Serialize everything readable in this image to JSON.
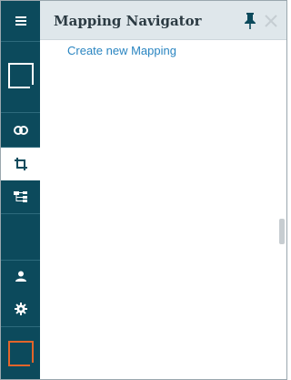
{
  "header": {
    "title": "Mapping Navigator"
  },
  "content": {
    "create_link": "Create new Mapping"
  },
  "rail": {
    "items": [
      {
        "icon": "menu-icon"
      },
      {
        "icon": "app-logo-icon"
      },
      {
        "icon": "link-icon"
      },
      {
        "icon": "crop-icon",
        "active": true
      },
      {
        "icon": "tree-icon"
      },
      {
        "icon": "user-icon"
      },
      {
        "icon": "gear-icon"
      },
      {
        "icon": "brand-logo-icon"
      }
    ]
  },
  "colors": {
    "rail": "#0c4a5c",
    "header": "#dfe7eb",
    "link": "#2a85c1",
    "brand_accent": "#e2652a",
    "pin": "#0c4a5c"
  }
}
